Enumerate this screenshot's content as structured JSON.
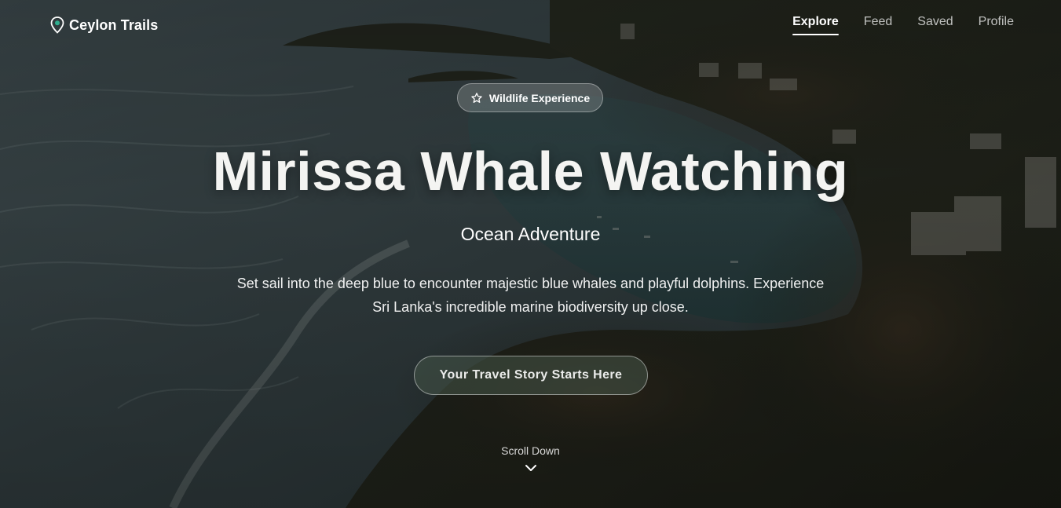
{
  "brand": {
    "name": "Ceylon Trails",
    "icon": "map-pin-icon",
    "accent": "#2fae8f"
  },
  "nav": {
    "items": [
      {
        "label": "Explore",
        "active": true
      },
      {
        "label": "Feed",
        "active": false
      },
      {
        "label": "Saved",
        "active": false
      },
      {
        "label": "Profile",
        "active": false
      }
    ]
  },
  "hero": {
    "badge": {
      "icon": "star-icon",
      "label": "Wildlife Experience"
    },
    "title": "Mirissa Whale Watching",
    "subtitle": "Ocean Adventure",
    "description": "Set sail into the deep blue to encounter majestic blue whales and playful dolphins. Experience Sri Lanka's incredible marine biodiversity up close.",
    "cta_label": "Your Travel Story Starts Here",
    "scroll_label": "Scroll Down",
    "scroll_icon": "chevron-down-icon"
  }
}
